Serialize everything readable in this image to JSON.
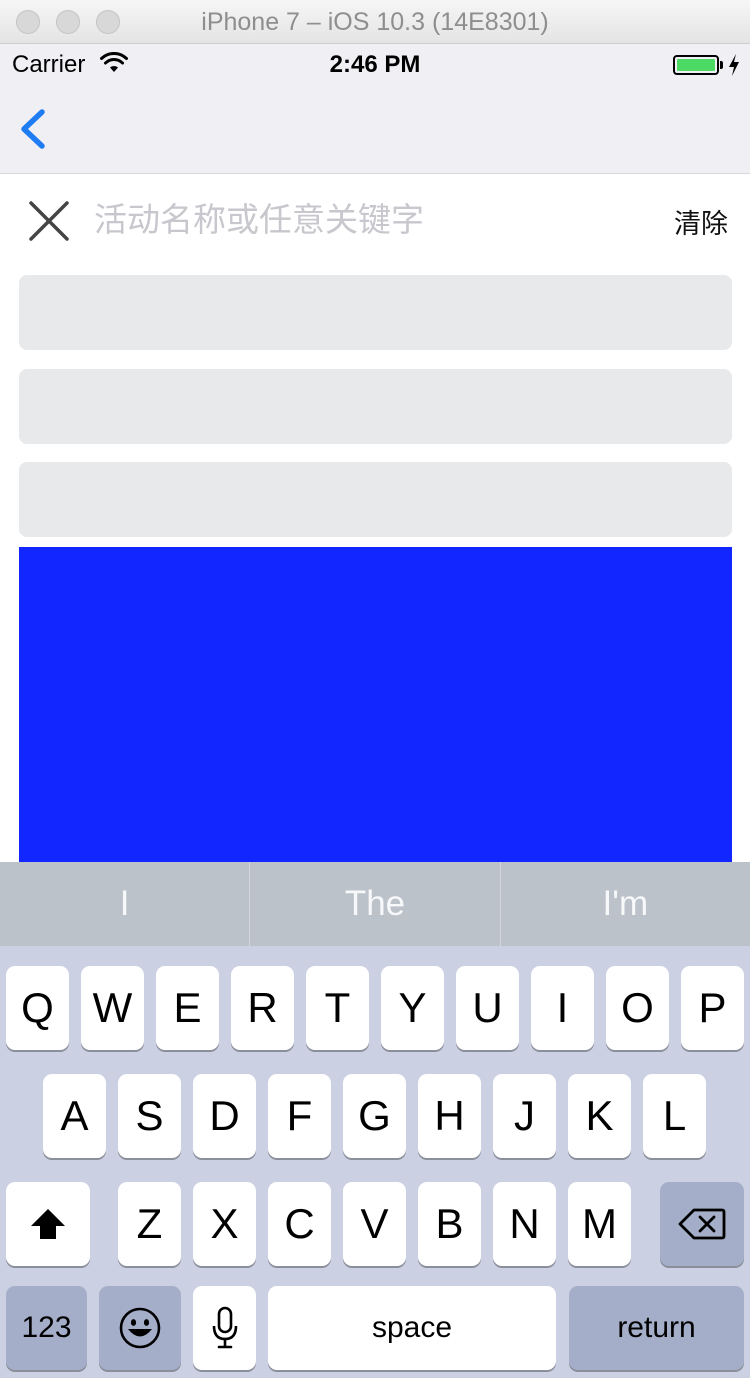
{
  "window": {
    "title": "iPhone 7 – iOS 10.3 (14E8301)"
  },
  "status_bar": {
    "carrier": "Carrier",
    "time": "2:46 PM"
  },
  "search": {
    "placeholder": "活动名称或任意关键字",
    "clear_label": "清除"
  },
  "predictive": [
    "I",
    "The",
    "I'm"
  ],
  "keyboard": {
    "row1": [
      "Q",
      "W",
      "E",
      "R",
      "T",
      "Y",
      "U",
      "I",
      "O",
      "P"
    ],
    "row2": [
      "A",
      "S",
      "D",
      "F",
      "G",
      "H",
      "J",
      "K",
      "L"
    ],
    "row3": [
      "Z",
      "X",
      "C",
      "V",
      "B",
      "N",
      "M"
    ],
    "numbers_label": "123",
    "space_label": "space",
    "return_label": "return"
  },
  "colors": {
    "accent": "#1f7cf2",
    "block": "#1226ff",
    "battery": "#4cd964"
  }
}
